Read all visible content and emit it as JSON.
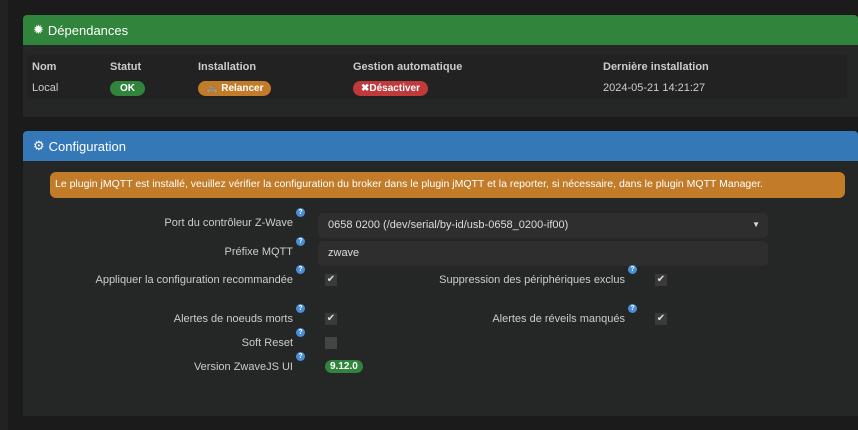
{
  "dependencies": {
    "title": "Dépendances",
    "headers": [
      "Nom",
      "Statut",
      "Installation",
      "Gestion automatique",
      "Dernière installation"
    ],
    "row": {
      "name": "Local",
      "status": "OK",
      "install": "Relancer",
      "auto": "Désactiver",
      "date": "2024-05-21 14:21:27"
    },
    "colors": {
      "header": "#31843b",
      "ok": "#31843b",
      "install": "#c27c29",
      "auto": "#c0393b"
    }
  },
  "configuration": {
    "title": "Configuration",
    "alert": "Le plugin jMQTT est installé, veuillez vérifier la configuration du broker dans le plugin jMQTT et la reporter, si nécessaire, dans le plugin MQTT Manager.",
    "port_label": "Port du contrôleur Z-Wave",
    "port_value": "0658 0200 (/dev/serial/by-id/usb-0658_0200-if00)",
    "prefix_label": "Préfixe MQTT",
    "prefix_value": "zwave",
    "apply_label": "Appliquer la configuration recommandée",
    "apply_checked": true,
    "exclude_label": "Suppression des périphériques exclus",
    "exclude_checked": true,
    "dead_label": "Alertes de noeuds morts",
    "dead_checked": true,
    "wake_label": "Alertes de réveils manqués",
    "wake_checked": true,
    "soft_label": "Soft Reset",
    "soft_checked": false,
    "version_label": "Version ZwaveJS UI",
    "version_value": "9.12.0",
    "help": "?",
    "check": "✔"
  }
}
